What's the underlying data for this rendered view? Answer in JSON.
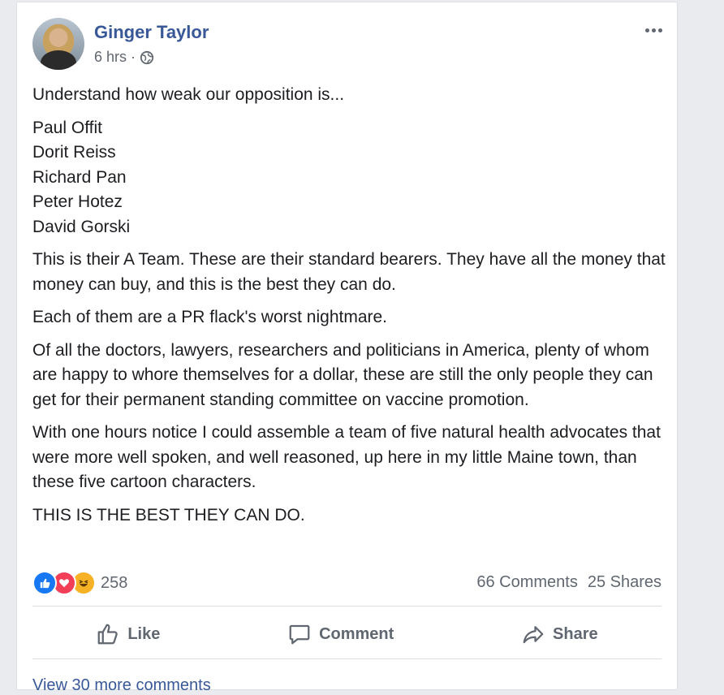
{
  "post": {
    "author": "Ginger Taylor",
    "time": "6 hrs",
    "separator": "·",
    "privacy_icon": "globe-icon",
    "menu_icon": "more-options-icon",
    "paragraphs": {
      "p1": "Understand how weak our opposition is...",
      "names": [
        "Paul Offit",
        "Dorit Reiss",
        "Richard Pan",
        "Peter Hotez",
        "David Gorski"
      ],
      "p2": "This is their A Team. These are their standard bearers. They have all the money that money can buy, and this is the best they can do.",
      "p3": "Each of them are a PR flack's worst nightmare.",
      "p4": "Of all the doctors, lawyers, researchers and politicians in America, plenty of whom are happy to whore themselves for a dollar, these are still the only people they can get for their permanent standing committee on vaccine promotion.",
      "p5": "With one hours notice I could assemble a team of five natural health advocates that were more well spoken, and well reasoned, up here in my little Maine town, than these five cartoon characters.",
      "p6": "THIS IS THE BEST THEY CAN DO."
    }
  },
  "engagement": {
    "reaction_icons": [
      "like-reaction-icon",
      "love-reaction-icon",
      "haha-reaction-icon"
    ],
    "reaction_count": "258",
    "comments": "66 Comments",
    "shares": "25 Shares"
  },
  "actions": {
    "like": "Like",
    "comment": "Comment",
    "share": "Share"
  },
  "comments": {
    "view_more": "View 30 more comments"
  },
  "colors": {
    "link_blue": "#385898",
    "secondary_text": "#606770",
    "like_blue": "#1877f2",
    "love_red": "#f33e58",
    "haha_yellow": "#f7b125"
  }
}
